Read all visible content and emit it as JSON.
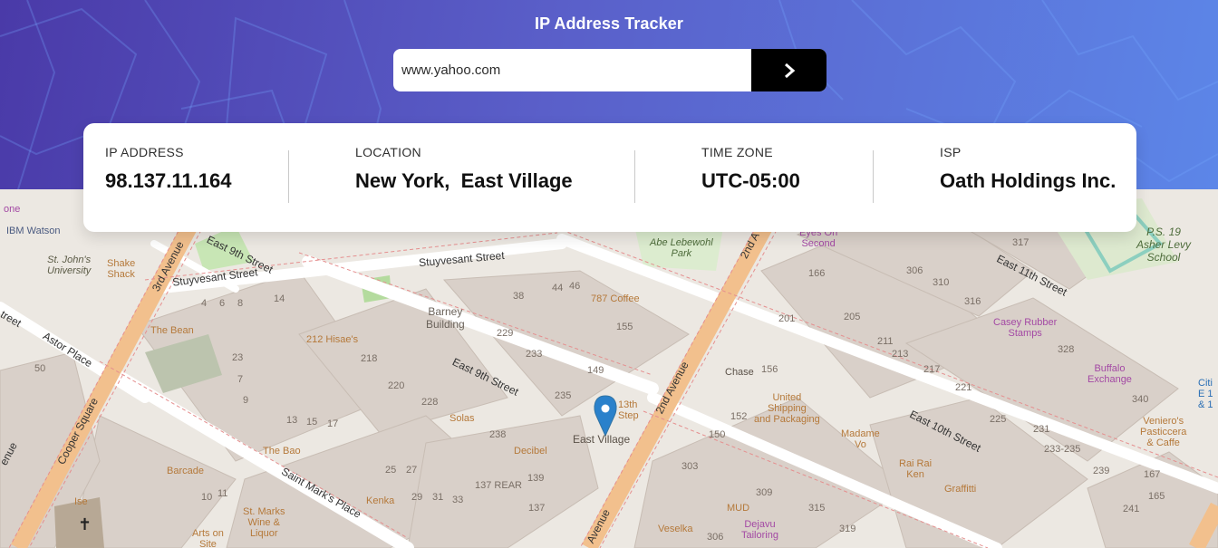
{
  "app": {
    "title": "IP Address Tracker"
  },
  "search": {
    "value": "www.yahoo.com",
    "button_icon": "chevron-right-icon"
  },
  "info": {
    "ip": {
      "label": "IP ADDRESS",
      "value": "98.137.11.164"
    },
    "location": {
      "label": "LOCATION",
      "value": "New York,  East Village"
    },
    "timezone": {
      "label": "TIME ZONE",
      "value": "UTC-05:00"
    },
    "isp": {
      "label": "ISP",
      "value": "Oath Holdings Inc."
    }
  },
  "map": {
    "marker_label": "East Village",
    "streets": {
      "stuyvesant_1": "Stuyvesant Street",
      "stuyvesant_2": "Stuyvesant Street",
      "east_9th_a": "East 9th Street",
      "east_9th_b": "East 9th Street",
      "east_10th": "East 10th Street",
      "east_11th": "East 11th Street",
      "astor_place": "Astor Place",
      "cooper_square": "Cooper Square",
      "saint_marks": "Saint Mark's Place",
      "third_avenue": "3rd Avenue",
      "second_avenue": "2nd Avenue",
      "second_avenue_top": "2nd A",
      "second_avenue_bottom": "Avenue",
      "avenue_bottom_left": "venue",
      "street_left": "treet",
      "street_left2": "enue"
    },
    "places": {
      "ibm": "IBM Watson",
      "st_johns": "St. John's\nUniversity",
      "shake_shack": "Shake\nShack",
      "abe_park": "Abe Lebewohl\nPark",
      "barney": "Barney\nBuilding",
      "coffee787": "787 Coffee",
      "the_bean": "The Bean",
      "hisaes": "212 Hisae's",
      "solas": "Solas",
      "decibel": "Decibel",
      "the_bao": "The Bao",
      "barcade": "Barcade",
      "kenka": "Kenka",
      "st_marks_wine": "St. Marks\nWine &\nLiquor",
      "arts_on": "Arts on\nSite",
      "ise": "Ise",
      "chase": "Chase",
      "ups": "United\nShipping\nand Packaging",
      "madame_vo": "Madame\nVo",
      "rai_rai": "Rai Rai\nKen",
      "graffiti": "Graffitti",
      "casey": "Casey Rubber\nStamps",
      "eyes_on": "Eyes On\nSecond",
      "buffalo": "Buffalo\nExchange",
      "veniero": "Veniero's\nPasticcera\n& Caffe",
      "ps19": "P.S. 19\nAsher Levy\nSchool",
      "mud": "MUD",
      "dejavu": "Dejavu\nTailoring",
      "veselka": "Veselka",
      "thirteenth": "13th\nStep",
      "citi": "Citi\nE 1\n& 1",
      "one": "one"
    },
    "numbers": [
      "4",
      "6",
      "8",
      "14",
      "38",
      "44",
      "46",
      "229",
      "233",
      "155",
      "149",
      "23",
      "218",
      "220",
      "228",
      "235",
      "238",
      "13",
      "15",
      "17",
      "25",
      "27",
      "29",
      "31",
      "33",
      "137 REAR",
      "139",
      "137",
      "166",
      "201",
      "205",
      "306",
      "310",
      "316",
      "211",
      "213",
      "217",
      "221",
      "225",
      "231",
      "233-235",
      "239",
      "167",
      "165",
      "241",
      "340",
      "317",
      "328",
      "156",
      "152",
      "150",
      "303",
      "309",
      "315",
      "319",
      "306",
      "7",
      "9",
      "10",
      "11",
      "50"
    ]
  }
}
